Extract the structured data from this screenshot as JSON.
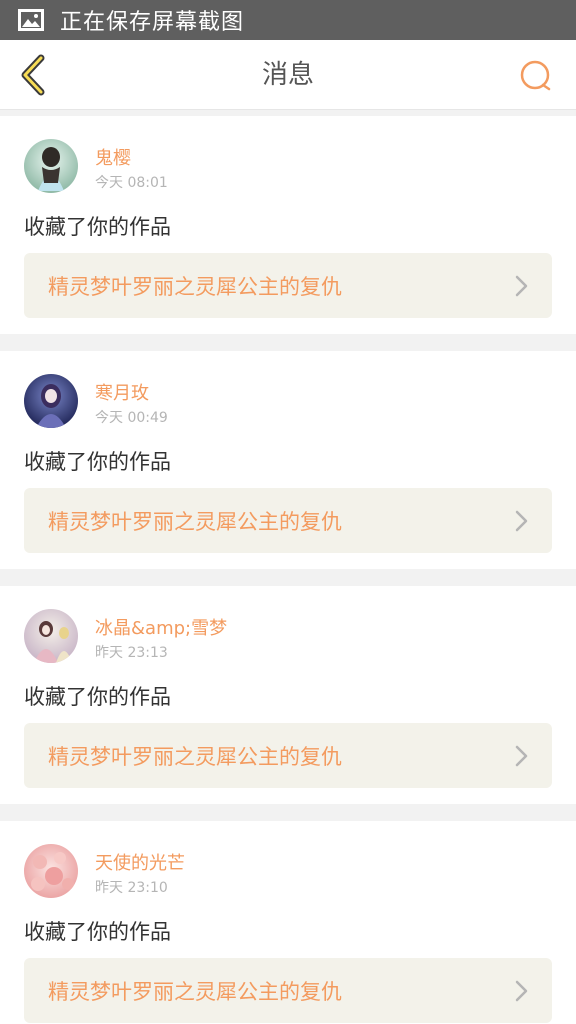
{
  "status_bar": {
    "text": "正在保存屏幕截图",
    "icon": "image-icon"
  },
  "header": {
    "title": "消息",
    "back_icon": "back-chevron-icon",
    "search_icon": "search-icon",
    "accent": "#f39b5f"
  },
  "messages": [
    {
      "username": "鬼樱",
      "time": "今天 08:01",
      "action": "收藏了你的作品",
      "work_title": "精灵梦叶罗丽之灵犀公主的复仇"
    },
    {
      "username": "寒月玫",
      "time": "今天 00:49",
      "action": "收藏了你的作品",
      "work_title": "精灵梦叶罗丽之灵犀公主的复仇"
    },
    {
      "username": "冰晶&amp;雪梦",
      "time": "昨天 23:13",
      "action": "收藏了你的作品",
      "work_title": "精灵梦叶罗丽之灵犀公主的复仇"
    },
    {
      "username": "天使的光芒",
      "time": "昨天 23:10",
      "action": "收藏了你的作品",
      "work_title": "精灵梦叶罗丽之灵犀公主的复仇"
    }
  ]
}
